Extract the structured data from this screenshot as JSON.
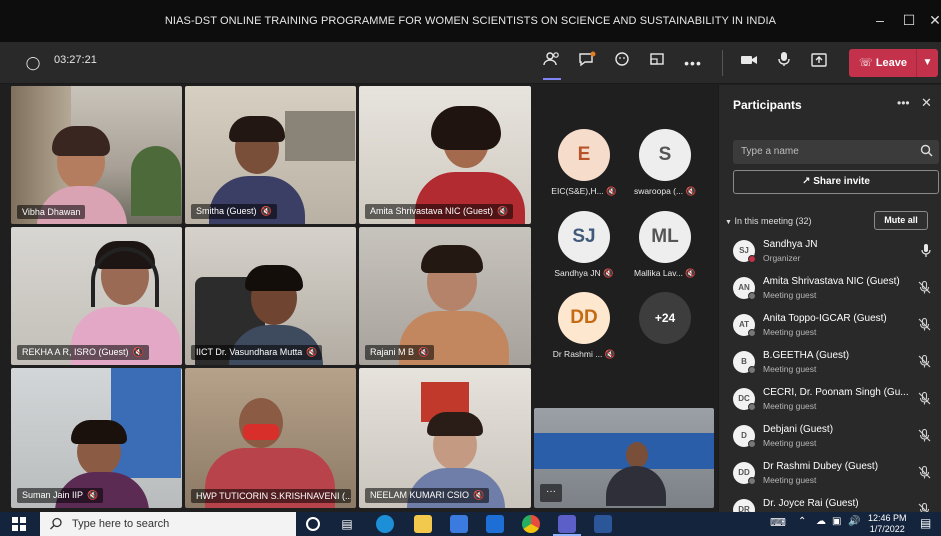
{
  "window": {
    "title": "NIAS-DST ONLINE TRAINING PROGRAMME FOR WOMEN SCIENTISTS ON SCIENCE AND SUSTAINABILITY IN INDIA",
    "min_icon": "minimize-icon",
    "max_icon": "maximize-icon",
    "close_icon": "close-icon"
  },
  "toolbar": {
    "timer": "03:27:21",
    "leave_label": "Leave",
    "leave_color": "#c4314b"
  },
  "videos": [
    {
      "name": "Vibha Dhawan",
      "muted": false
    },
    {
      "name": "Smitha (Guest)",
      "muted": true
    },
    {
      "name": "Amita Shrivastava NIC (Guest)",
      "muted": true
    },
    {
      "name": "REKHA A R, ISRO (Guest)",
      "muted": true
    },
    {
      "name": "IICT Dr. Vasundhara Mutta",
      "muted": true
    },
    {
      "name": "Rajani M B",
      "muted": true
    },
    {
      "name": "Suman Jain IIP",
      "muted": true
    },
    {
      "name": "HWP TUTICORIN S.KRISHNAVENI (...",
      "muted": false
    },
    {
      "name": "NEELAM KUMARI CSIO",
      "muted": true
    }
  ],
  "avatars": [
    {
      "initials": "E",
      "name": "EIC(S&E),H...",
      "bg": "#f6dccb",
      "fg": "#b8542a"
    },
    {
      "initials": "S",
      "name": "swaroopa (...",
      "bg": "#eeeeee",
      "fg": "#555555"
    },
    {
      "initials": "SJ",
      "name": "Sandhya JN",
      "bg": "#eeeeee",
      "fg": "#3f5a7a"
    },
    {
      "initials": "ML",
      "name": "Mallika Lav...",
      "bg": "#eeeeee",
      "fg": "#555555"
    },
    {
      "initials": "DD",
      "name": "Dr Rashmi ...",
      "bg": "#fde7cf",
      "fg": "#c46a14"
    },
    {
      "initials": "+24",
      "name": "",
      "bg": "#3d3d3d",
      "fg": "#ffffff"
    }
  ],
  "panel": {
    "title": "Participants",
    "search_placeholder": "Type a name",
    "share_invite": "Share invite",
    "in_meeting": "In this meeting (32)",
    "mute_all": "Mute all",
    "participants": [
      {
        "initials": "SJ",
        "name": "Sandhya JN",
        "role": "Organizer",
        "mic": "mic-on"
      },
      {
        "initials": "AN",
        "name": "Amita Shrivastava NIC (Guest)",
        "role": "Meeting guest",
        "mic": "mic-off"
      },
      {
        "initials": "AT",
        "name": "Anita Toppo-IGCAR (Guest)",
        "role": "Meeting guest",
        "mic": "mic-off"
      },
      {
        "initials": "B",
        "name": "B.GEETHA (Guest)",
        "role": "Meeting guest",
        "mic": "mic-off"
      },
      {
        "initials": "DC",
        "name": "CECRI, Dr. Poonam Singh (Gu...",
        "role": "Meeting guest",
        "mic": "mic-off"
      },
      {
        "initials": "D",
        "name": "Debjani (Guest)",
        "role": "Meeting guest",
        "mic": "mic-off"
      },
      {
        "initials": "DD",
        "name": "Dr Rashmi Dubey (Guest)",
        "role": "Meeting guest",
        "mic": "mic-off"
      },
      {
        "initials": "DR",
        "name": "Dr. Joyce Rai (Guest)",
        "role": "",
        "mic": "mic-off"
      }
    ]
  },
  "taskbar": {
    "search_placeholder": "Type here to search",
    "time": "12:46 PM",
    "date": "1/7/2022"
  }
}
